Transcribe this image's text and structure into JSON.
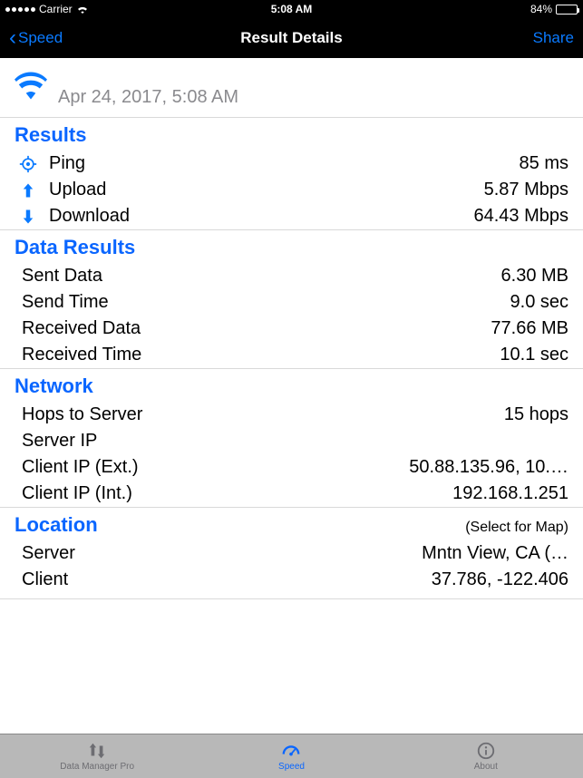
{
  "status_bar": {
    "carrier": "Carrier",
    "time": "5:08 AM",
    "battery_pct": "84%"
  },
  "nav": {
    "back_label": "Speed",
    "title": "Result Details",
    "share_label": "Share"
  },
  "header": {
    "timestamp": "Apr 24, 2017, 5:08 AM"
  },
  "results": {
    "title": "Results",
    "ping_label": "Ping",
    "ping_value": "85 ms",
    "upload_label": "Upload",
    "upload_value": "5.87 Mbps",
    "download_label": "Download",
    "download_value": "64.43 Mbps"
  },
  "data_results": {
    "title": "Data Results",
    "sent_data_label": "Sent Data",
    "sent_data_value": "6.30 MB",
    "send_time_label": "Send Time",
    "send_time_value": "9.0 sec",
    "received_data_label": "Received Data",
    "received_data_value": "77.66 MB",
    "received_time_label": "Received Time",
    "received_time_value": "10.1 sec"
  },
  "network": {
    "title": "Network",
    "hops_label": "Hops to Server",
    "hops_value": "15 hops",
    "server_ip_label": "Server IP",
    "server_ip_value": "",
    "client_ip_ext_label": "Client IP (Ext.)",
    "client_ip_ext_value": "50.88.135.96, 10.…",
    "client_ip_int_label": "Client IP (Int.)",
    "client_ip_int_value": "192.168.1.251"
  },
  "location": {
    "title": "Location",
    "hint": "(Select for Map)",
    "server_label": "Server",
    "server_value": "Mntn View, CA (…",
    "client_label": "Client",
    "client_value": "37.786, -122.406"
  },
  "tabs": {
    "data_manager": "Data Manager Pro",
    "speed": "Speed",
    "about": "About"
  }
}
